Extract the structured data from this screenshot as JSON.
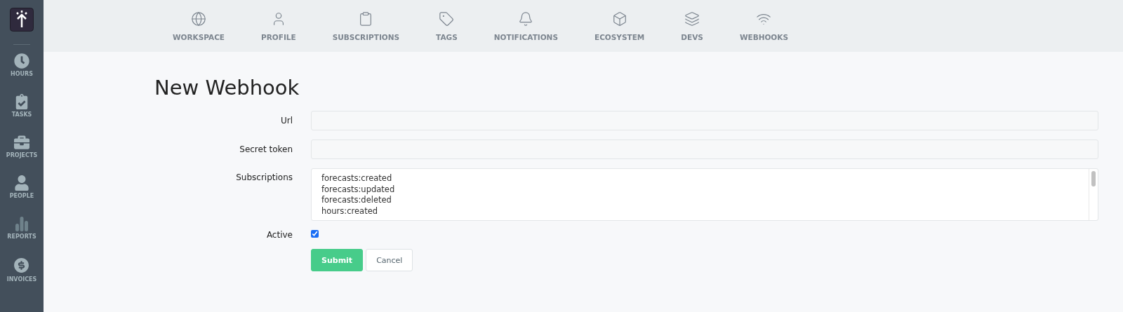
{
  "sidebar": {
    "items": [
      {
        "kind": "hours",
        "label": "HOURS"
      },
      {
        "kind": "tasks",
        "label": "TASKS"
      },
      {
        "kind": "projects",
        "label": "PROJECTS"
      },
      {
        "kind": "people",
        "label": "PEOPLE"
      },
      {
        "kind": "reports",
        "label": "REPORTS"
      },
      {
        "kind": "invoices",
        "label": "INVOICES"
      }
    ]
  },
  "top_nav": {
    "items": [
      {
        "kind": "workspace",
        "label": "WORKSPACE"
      },
      {
        "kind": "profile",
        "label": "PROFILE"
      },
      {
        "kind": "subscriptions",
        "label": "SUBSCRIPTIONS"
      },
      {
        "kind": "tags",
        "label": "TAGS"
      },
      {
        "kind": "notifications",
        "label": "NOTIFICATIONS"
      },
      {
        "kind": "ecosystem",
        "label": "ECOSYSTEM"
      },
      {
        "kind": "devs",
        "label": "DEVS"
      },
      {
        "kind": "webhooks",
        "label": "WEBHOOKS"
      }
    ]
  },
  "page": {
    "title": "New Webhook"
  },
  "form": {
    "fields": [
      {
        "kind": "text",
        "label": "Url"
      },
      {
        "kind": "text",
        "label": "Secret token"
      },
      {
        "kind": "multiselect",
        "label": "Subscriptions",
        "options": [
          "forecasts:created",
          "forecasts:updated",
          "forecasts:deleted",
          "hours:created"
        ]
      },
      {
        "kind": "checkbox",
        "label": "Active",
        "checked": true
      }
    ],
    "buttons": [
      {
        "kind": "primary",
        "label": "Submit"
      },
      {
        "kind": "secondary",
        "label": "Cancel"
      }
    ]
  }
}
